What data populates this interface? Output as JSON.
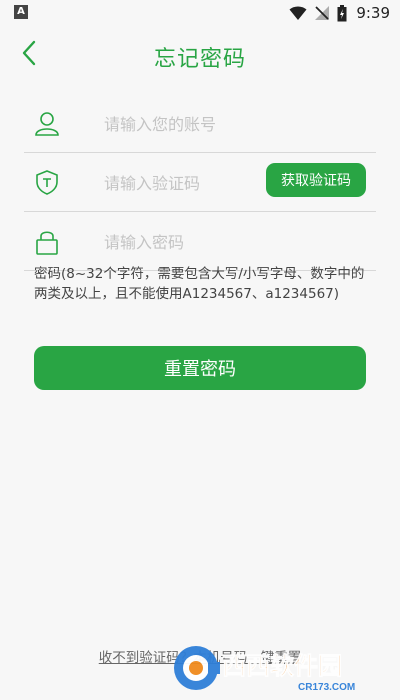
{
  "status_bar": {
    "left_icon": "A",
    "time": "9:39",
    "icons": [
      "wifi-icon",
      "no-signal-icon",
      "battery-charging-icon"
    ]
  },
  "header": {
    "back_icon": "chevron-left-icon",
    "title": "忘记密码"
  },
  "form": {
    "account": {
      "icon": "user-icon",
      "placeholder": "请输入您的账号",
      "value": ""
    },
    "code": {
      "icon": "shield-icon",
      "placeholder": "请输入验证码",
      "value": "",
      "button_label": "获取验证码"
    },
    "password": {
      "icon": "lock-icon",
      "placeholder": "请输入密码",
      "value": ""
    },
    "hint": "密码(8~32个字符，需要包含大写/小写字母、数字中的两类及以上，且不能使用A1234567、a1234567)",
    "submit_label": "重置密码"
  },
  "footer": {
    "link_text": "收不到验证码？本机号码一键重置"
  },
  "watermark": {
    "text": "西西软件园",
    "subtext": "CR173.COM"
  },
  "colors": {
    "accent": "#29a544",
    "background": "#f7f7f7",
    "placeholder": "#c4c4c4"
  }
}
